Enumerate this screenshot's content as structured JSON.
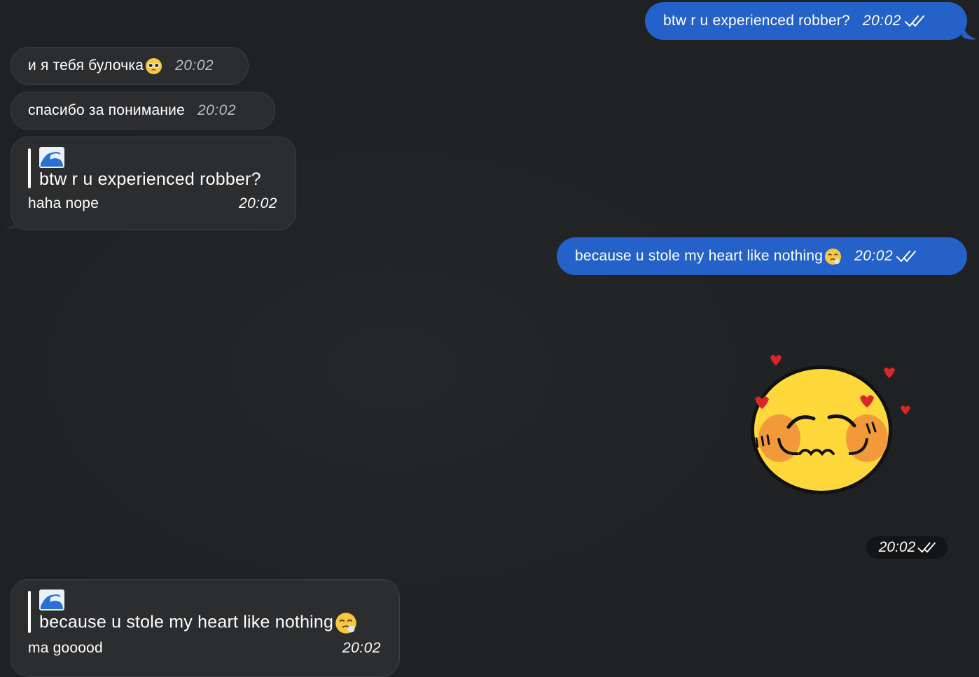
{
  "messages": {
    "m1": {
      "text": "btw r u experienced robber?",
      "time": "20:02"
    },
    "m2": {
      "text": "и я тебя булочка",
      "time": "20:02"
    },
    "m3": {
      "text": "спасибо за понимание",
      "time": "20:02"
    },
    "m4": {
      "quote": "btw r u experienced robber?",
      "text": "haha nope",
      "time": "20:02"
    },
    "m5": {
      "text": "because u stole my heart like nothing",
      "time": "20:02"
    },
    "m6": {
      "time": "20:02"
    },
    "m7": {
      "quote": "because u stole my heart like nothing",
      "text": "ma gooood",
      "time": "20:02"
    }
  },
  "colors": {
    "background": "#1f2123",
    "outgoing_bubble": "#2462c9",
    "incoming_bubble": "#2c2d2f",
    "sticker_face": "#ffd93b",
    "sticker_hearts": "#d8262b"
  },
  "icons": {
    "read_receipt": "double-check-icon",
    "reply_avatar": "wave-icon",
    "sticker": "shy-emoji-sticker"
  }
}
